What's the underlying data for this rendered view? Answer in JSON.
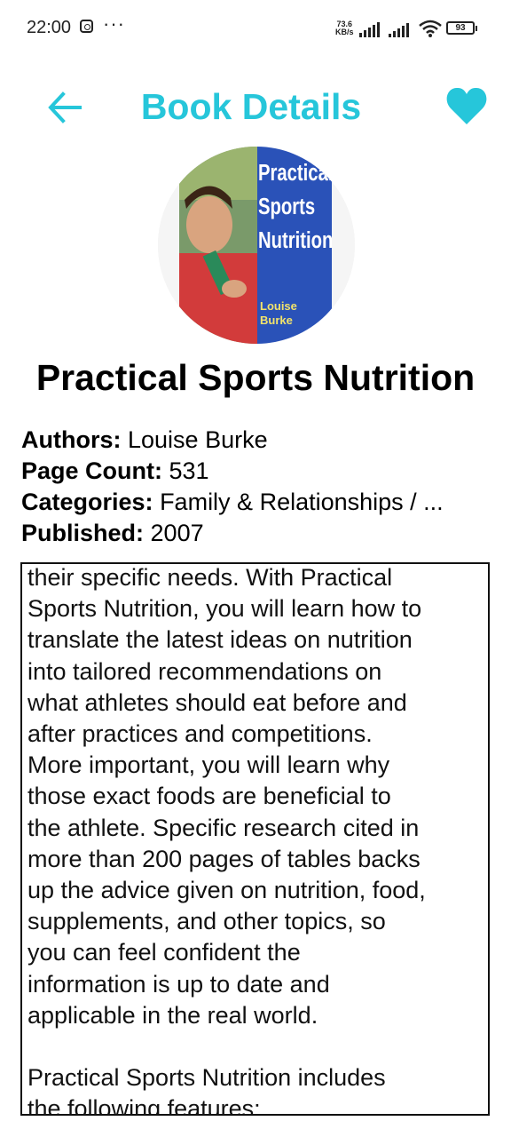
{
  "status_bar": {
    "time": "22:00",
    "net_speed_value": "73.6",
    "net_speed_unit": "KB/s",
    "battery": "93"
  },
  "app_bar": {
    "title": "Book Details",
    "accent_color": "#26c6da",
    "back_icon": "arrow-left-icon",
    "favorite_icon": "heart-icon"
  },
  "book": {
    "title": "Practical Sports Nutrition",
    "cover": {
      "title_line1": "Practical",
      "title_line2": "Sports",
      "title_line3": "Nutrition",
      "author_line1": "Louise",
      "author_line2": "Burke"
    },
    "authors_label": "Authors:",
    "authors_value": "Louise Burke",
    "page_count_label": "Page Count:",
    "page_count_value": "531",
    "categories_label": "Categories:",
    "categories_value": "Family & Relationships / ...",
    "published_label": "Published:",
    "published_value": "2007",
    "description": "their specific needs. With Practical\nSports Nutrition, you will learn how to\ntranslate the latest ideas on nutrition\ninto tailored recommendations on\nwhat athletes should eat before and\nafter practices and competitions.\nMore important, you will learn why\nthose exact foods are beneficial to\nthe athlete. Specific research cited in\nmore than 200 pages of tables backs\nup the advice given on nutrition, food,\nsupplements, and other topics, so\nyou can feel confident the\ninformation is up to date and\napplicable in the real world.\n\nPractical Sports Nutrition includes\nthe following features:"
  }
}
